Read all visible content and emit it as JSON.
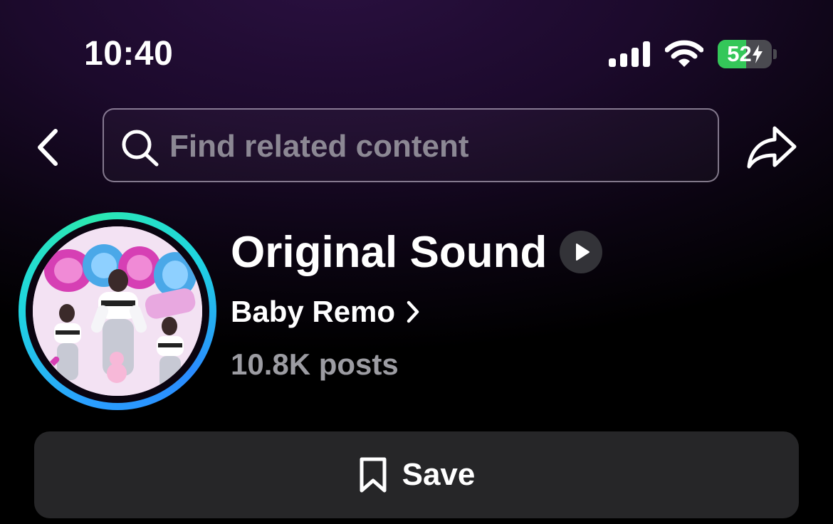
{
  "status_bar": {
    "time": "10:40",
    "battery_percent": 52,
    "battery_label": "52",
    "icons": [
      "signal-icon",
      "wifi-icon",
      "battery-icon",
      "charging-bolt-icon"
    ]
  },
  "nav": {
    "back_icon": "chevron-left-icon",
    "search_placeholder": "Find related content",
    "search_icon": "search-icon",
    "share_icon": "share-arrow-icon"
  },
  "sound": {
    "title": "Original Sound",
    "artist": "Baby Remo",
    "posts": "10.8K posts",
    "cover_ring_colors": [
      "#2aa0ff",
      "#1fd6e0",
      "#2be8b0"
    ]
  },
  "actions": {
    "save_label": "Save",
    "save_icon": "bookmark-icon"
  },
  "colors": {
    "background_top": "#2a1040",
    "button_background": "#262628",
    "secondary_text": "#9c9ca2",
    "battery_green": "#34c759"
  }
}
